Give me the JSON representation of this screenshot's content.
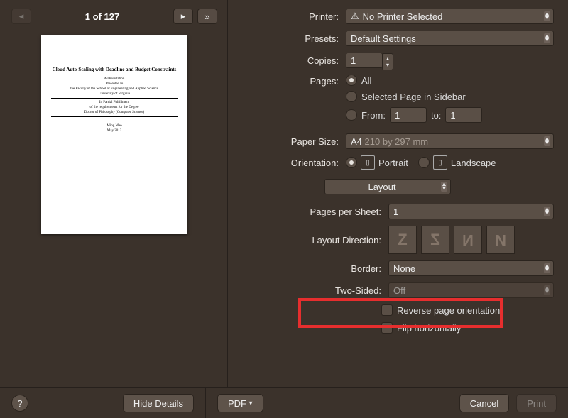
{
  "preview": {
    "page_indicator": "1 of 127",
    "doc_title": "Cloud Auto-Scaling with Deadline and Budget Constraints",
    "doc_sub1": "A Dissertation",
    "doc_sub2": "Presented to",
    "doc_sub3": "the Faculty of the School of Engineering and Applied Science",
    "doc_sub4": "University of Virginia",
    "doc_sub5": "In Partial Fulfillment",
    "doc_sub6": "of the requirements for the Degree",
    "doc_sub7": "Doctor of Philosophy (Computer Science)",
    "doc_author": "Ming Mao",
    "doc_date": "May 2012"
  },
  "labels": {
    "printer": "Printer:",
    "presets": "Presets:",
    "copies": "Copies:",
    "pages": "Pages:",
    "paper_size": "Paper Size:",
    "orientation": "Orientation:",
    "pages_per_sheet": "Pages per Sheet:",
    "layout_direction": "Layout Direction:",
    "border": "Border:",
    "two_sided": "Two-Sided:"
  },
  "printer": {
    "value": "No Printer Selected"
  },
  "presets": {
    "value": "Default Settings"
  },
  "copies": "1",
  "pages": {
    "all": "All",
    "selected": "Selected Page in Sidebar",
    "from_label": "From:",
    "from_value": "1",
    "to_label": "to:",
    "to_value": "1"
  },
  "paper_size": {
    "value": "A4",
    "hint": "210 by 297 mm"
  },
  "orientation": {
    "portrait": "Portrait",
    "landscape": "Landscape"
  },
  "section_popup": "Layout",
  "pages_per_sheet": "1",
  "border": "None",
  "two_sided": "Off",
  "checkboxes": {
    "reverse": "Reverse page orientation",
    "flip": "Flip horizontally"
  },
  "buttons": {
    "hide_details": "Hide Details",
    "pdf": "PDF",
    "cancel": "Cancel",
    "print": "Print",
    "help": "?"
  }
}
